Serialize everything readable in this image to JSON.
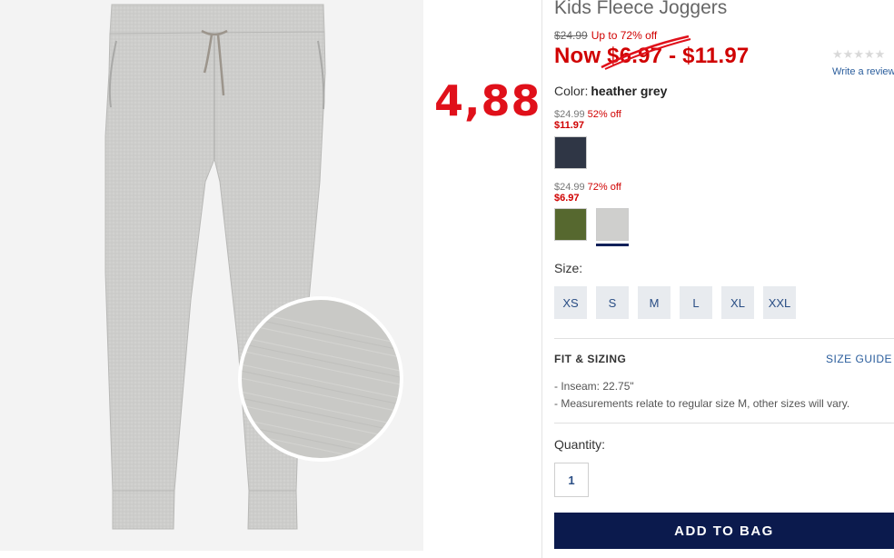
{
  "annotation": {
    "handwritten_price": "4,88"
  },
  "product": {
    "title": "Kids Fleece Joggers",
    "original_price": "$24.99",
    "discount_text": "Up to 72% off",
    "now_label": "Now",
    "now_low": "$6.97",
    "now_separator": "-",
    "now_high": "$11.97"
  },
  "rating": {
    "stars": "★★★★★",
    "review_link": "Write a review"
  },
  "color": {
    "label": "Color:",
    "selected": "heather grey"
  },
  "swatch_groups": [
    {
      "original_price": "$24.99",
      "discount": "52% off",
      "sale_price": "$11.97",
      "swatches": [
        {
          "color": "#2f3645",
          "name": "navy heather"
        }
      ]
    },
    {
      "original_price": "$24.99",
      "discount": "72% off",
      "sale_price": "$6.97",
      "swatches": [
        {
          "color": "#56682f",
          "name": "olive"
        },
        {
          "color": "#cfcfcd",
          "name": "heather grey"
        }
      ]
    }
  ],
  "size": {
    "label": "Size:",
    "options": [
      "XS",
      "S",
      "M",
      "L",
      "XL",
      "XXL"
    ]
  },
  "fit": {
    "title": "FIT & SIZING",
    "size_guide": "SIZE GUIDE",
    "details": [
      "- Inseam: 22.75\"",
      "- Measurements relate to regular size M, other sizes will vary."
    ]
  },
  "quantity": {
    "label": "Quantity:",
    "value": "1"
  },
  "cta": {
    "add_to_bag": "ADD TO BAG"
  },
  "colors": {
    "accent_red": "#d00000",
    "navy": "#0b1a4d",
    "link_blue": "#2a5d9c",
    "annotation_red": "#e0101a"
  }
}
